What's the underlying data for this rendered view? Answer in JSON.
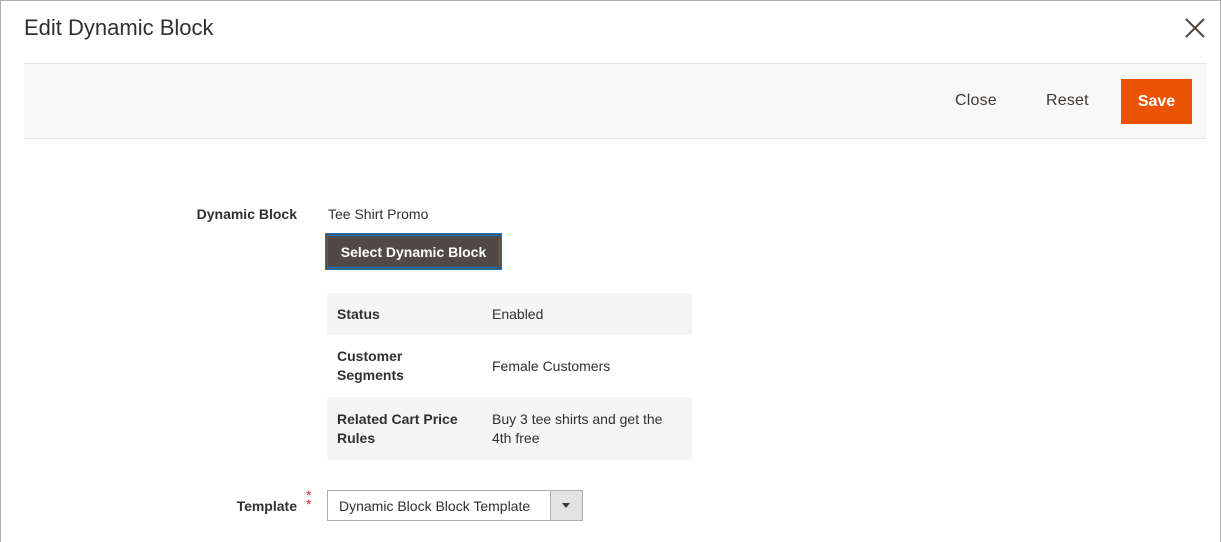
{
  "modal": {
    "title": "Edit Dynamic Block"
  },
  "toolbar": {
    "close_label": "Close",
    "reset_label": "Reset",
    "save_label": "Save"
  },
  "form": {
    "dynamic_block_label": "Dynamic Block",
    "dynamic_block_value": "Tee Shirt Promo",
    "select_button_label": "Select Dynamic Block",
    "details": [
      {
        "key": "Status",
        "value": "Enabled"
      },
      {
        "key": "Customer Segments",
        "value": "Female Customers"
      },
      {
        "key": "Related Cart Price Rules",
        "value": "Buy 3 tee shirts and get the 4th free"
      }
    ],
    "template_label": "Template",
    "template_required_mark": "*",
    "template_value": "Dynamic Block Block Template"
  },
  "colors": {
    "primary_button": "#eb5202",
    "secondary_button": "#514943",
    "action_bar_bg": "#f8f8f8",
    "required": "#e22626"
  }
}
